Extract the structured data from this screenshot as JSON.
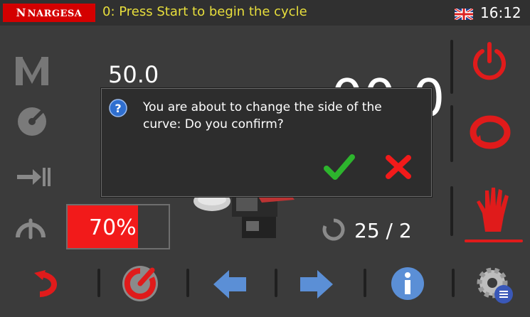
{
  "header": {
    "brand": "NARGESA",
    "status_message": "0: Press Start to begin the cycle",
    "language_flag": "uk-flag-icon",
    "time": "16:12"
  },
  "readouts": {
    "top_value": "50.0",
    "big_value": "00.0",
    "speed_percent": 70,
    "speed_label": "70%",
    "counter": "25 /  2"
  },
  "dialog": {
    "message": "You are about to change the side of the curve: Do you confirm?",
    "confirm_icon": "check-icon",
    "cancel_icon": "x-icon"
  },
  "left_panel": {
    "icons": [
      "manual-mode-icon",
      "gauge-icon",
      "limit-icon",
      "arc-icon"
    ]
  },
  "right_panel": {
    "icons": [
      "power-icon",
      "cycle-icon",
      "hand-stop-icon"
    ]
  },
  "bottom_toolbar": {
    "icons": [
      "curve-side-icon",
      "start-icon",
      "arrow-left-icon",
      "arrow-right-icon",
      "info-icon",
      "settings-icon"
    ]
  },
  "colors": {
    "accent_red": "#e01b1b",
    "status_yellow": "#e8df3c",
    "confirm_green": "#2db52d",
    "blue": "#5b8fd6"
  }
}
